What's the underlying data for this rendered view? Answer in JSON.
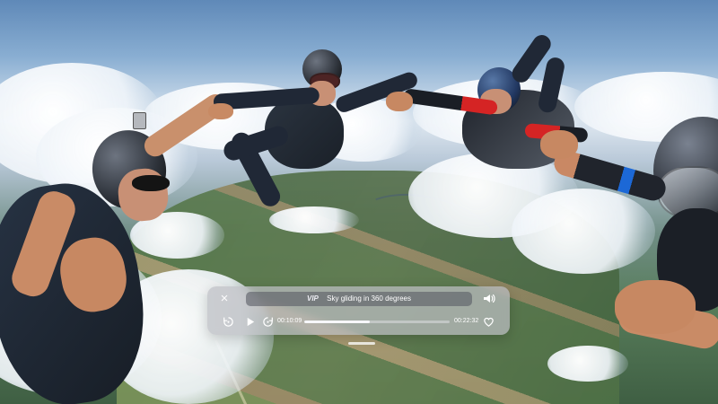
{
  "player": {
    "close_icon": "close-icon",
    "brand": "VIP",
    "title": "Sky gliding in 360 degrees",
    "volume_icon": "speaker-icon",
    "rewind_icon": "rewind-10-icon",
    "play_icon": "play-icon",
    "forward_icon": "forward-10-icon",
    "current_time": "00:10:09",
    "total_time": "00:22:32",
    "progress_fraction": 0.45,
    "favorite_icon": "heart-icon",
    "handle_icon": "drag-handle-icon"
  },
  "colors": {
    "player_background": "#bcc0c8",
    "title_strip": "#5a5e68",
    "text": "#ffffff",
    "accent_red": "#d52424",
    "sky": "#6f94c2"
  }
}
